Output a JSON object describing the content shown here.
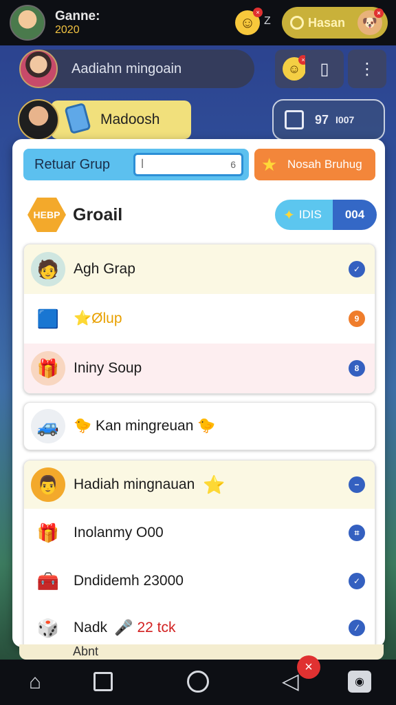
{
  "topbar": {
    "title_line1": "Ganne:",
    "title_line2": "2020",
    "emoji_badge": "×",
    "emoji_suffix": "Z",
    "pill_label": "Hasan",
    "pill_badge": "×"
  },
  "search": {
    "text": "Aadiahn mingoain",
    "emoji_badge": "×"
  },
  "second_row": {
    "pill_label": "Madoosh",
    "right_value1": "97",
    "right_value2": "I007"
  },
  "card": {
    "tab_blue_label": "Retuar Grup",
    "tab_blue_input_left": "ꟾ",
    "tab_blue_input_right": "6",
    "tab_orange_label": "Nosah Bruhug",
    "group": {
      "hex_label": "HEBP",
      "title": "Groail",
      "chip_blue_label": "IDIS",
      "chip_dark_label": "004"
    },
    "list1": [
      {
        "label": "Agh Grap",
        "icon": "person-icon",
        "bg": "#fbf8e3",
        "action_color": "blue",
        "action_glyph": "✓"
      },
      {
        "label": "⭐Ølup",
        "icon": "blue-box-icon",
        "bg": "#ffffff",
        "action_color": "orange",
        "action_glyph": "9"
      },
      {
        "label": "Ininy Soup",
        "icon": "gift-icon",
        "bg": "#fdeef0",
        "action_color": "blue",
        "action_glyph": "8"
      }
    ],
    "single_row": {
      "label": "🐤 Kan mingreuan 🐤",
      "icon": "car-icon"
    },
    "list2": [
      {
        "label": "Hadiah mingnauan",
        "emoji": "⭐",
        "icon": "man-avatar-icon",
        "bg": "#fbf8e3",
        "action_glyph": "−"
      },
      {
        "label": "Inolanmy O00",
        "emoji": "",
        "icon": "gold-gift-icon",
        "bg": "#ffffff",
        "action_glyph": "⌗"
      },
      {
        "label": "Dndidemh 23000",
        "emoji": "",
        "icon": "treasure-cart-icon",
        "bg": "#ffffff",
        "action_glyph": "✓"
      },
      {
        "label": "Nadk",
        "emoji": "🎤",
        "extra": "22 tck",
        "icon": "game-box-icon",
        "bg": "#ffffff",
        "action_glyph": "⁄"
      }
    ]
  },
  "peek_text": "Abnt",
  "navbar": {
    "close_badge": "×"
  },
  "colors": {
    "accent_blue": "#5cc0ef",
    "accent_orange": "#f3863a",
    "dark_blue": "#3468c6",
    "red_text": "#d22020"
  }
}
